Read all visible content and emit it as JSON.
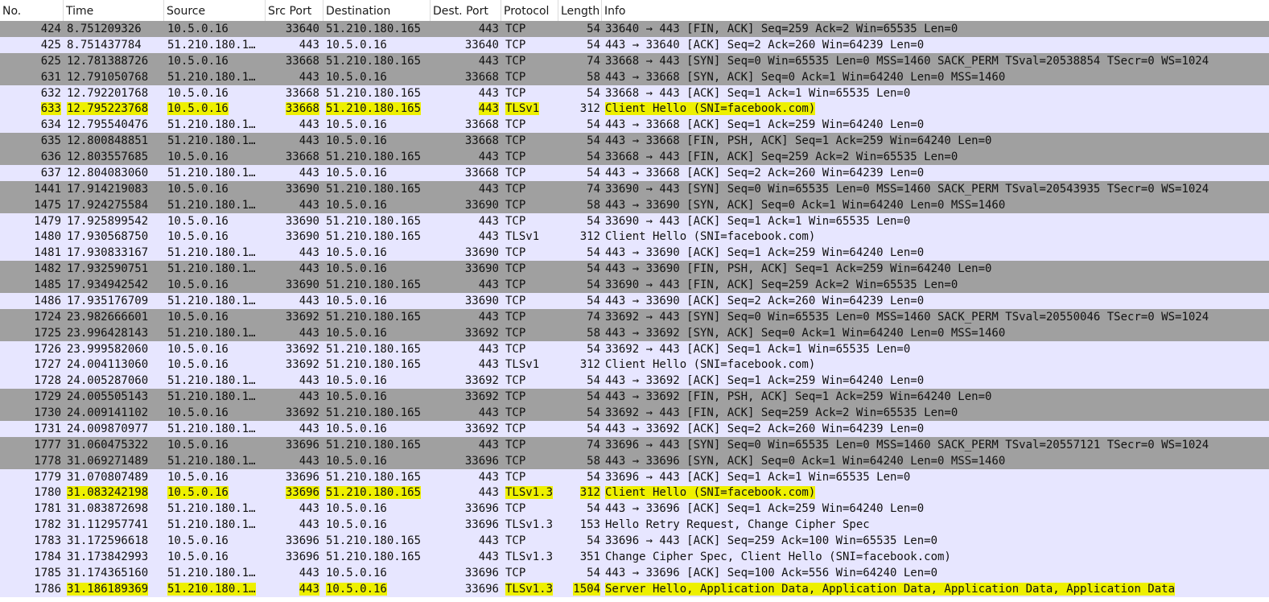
{
  "columns": [
    {
      "key": "no",
      "label": "No."
    },
    {
      "key": "time",
      "label": "Time"
    },
    {
      "key": "source",
      "label": "Source"
    },
    {
      "key": "src_port",
      "label": "Src Port"
    },
    {
      "key": "destination",
      "label": "Destination"
    },
    {
      "key": "dest_port",
      "label": "Dest. Port"
    },
    {
      "key": "protocol",
      "label": "Protocol"
    },
    {
      "key": "length",
      "label": "Length"
    },
    {
      "key": "info",
      "label": "Info"
    }
  ],
  "colors": {
    "row_gray": "#a0a0a0",
    "row_lavender": "#e7e6ff",
    "highlight": "#eef000"
  },
  "rows": [
    {
      "no": "424",
      "time": "8.751209326",
      "source": "10.5.0.16",
      "src_port": "33640",
      "destination": "51.210.180.165",
      "dest_port": "443",
      "protocol": "TCP",
      "length": "54",
      "info": "33640 → 443 [FIN, ACK] Seq=259 Ack=2 Win=65535 Len=0",
      "bg": "gray"
    },
    {
      "no": "425",
      "time": "8.751437784",
      "source": "51.210.180.1…",
      "src_port": "443",
      "destination": "10.5.0.16",
      "dest_port": "33640",
      "protocol": "TCP",
      "length": "54",
      "info": "443 → 33640 [ACK] Seq=2 Ack=260 Win=64239 Len=0",
      "bg": "lavender"
    },
    {
      "no": "625",
      "time": "12.781388726",
      "source": "10.5.0.16",
      "src_port": "33668",
      "destination": "51.210.180.165",
      "dest_port": "443",
      "protocol": "TCP",
      "length": "74",
      "info": "33668 → 443 [SYN] Seq=0 Win=65535 Len=0 MSS=1460 SACK_PERM TSval=20538854 TSecr=0 WS=1024",
      "bg": "gray"
    },
    {
      "no": "631",
      "time": "12.791050768",
      "source": "51.210.180.1…",
      "src_port": "443",
      "destination": "10.5.0.16",
      "dest_port": "33668",
      "protocol": "TCP",
      "length": "58",
      "info": "443 → 33668 [SYN, ACK] Seq=0 Ack=1 Win=64240 Len=0 MSS=1460",
      "bg": "gray"
    },
    {
      "no": "632",
      "time": "12.792201768",
      "source": "10.5.0.16",
      "src_port": "33668",
      "destination": "51.210.180.165",
      "dest_port": "443",
      "protocol": "TCP",
      "length": "54",
      "info": "33668 → 443 [ACK] Seq=1 Ack=1 Win=65535 Len=0",
      "bg": "lavender"
    },
    {
      "no": "633",
      "time": "12.795223768",
      "source": "10.5.0.16",
      "src_port": "33668",
      "destination": "51.210.180.165",
      "dest_port": "443",
      "protocol": "TLSv1",
      "length": "312",
      "info": "Client Hello (SNI=facebook.com)",
      "bg": "lavender",
      "highlight": [
        "no",
        "time",
        "source",
        "src_port",
        "destination",
        "dest_port",
        "protocol",
        "info"
      ]
    },
    {
      "no": "634",
      "time": "12.795540476",
      "source": "51.210.180.1…",
      "src_port": "443",
      "destination": "10.5.0.16",
      "dest_port": "33668",
      "protocol": "TCP",
      "length": "54",
      "info": "443 → 33668 [ACK] Seq=1 Ack=259 Win=64240 Len=0",
      "bg": "lavender"
    },
    {
      "no": "635",
      "time": "12.800848851",
      "source": "51.210.180.1…",
      "src_port": "443",
      "destination": "10.5.0.16",
      "dest_port": "33668",
      "protocol": "TCP",
      "length": "54",
      "info": "443 → 33668 [FIN, PSH, ACK] Seq=1 Ack=259 Win=64240 Len=0",
      "bg": "gray"
    },
    {
      "no": "636",
      "time": "12.803557685",
      "source": "10.5.0.16",
      "src_port": "33668",
      "destination": "51.210.180.165",
      "dest_port": "443",
      "protocol": "TCP",
      "length": "54",
      "info": "33668 → 443 [FIN, ACK] Seq=259 Ack=2 Win=65535 Len=0",
      "bg": "gray"
    },
    {
      "no": "637",
      "time": "12.804083060",
      "source": "51.210.180.1…",
      "src_port": "443",
      "destination": "10.5.0.16",
      "dest_port": "33668",
      "protocol": "TCP",
      "length": "54",
      "info": "443 → 33668 [ACK] Seq=2 Ack=260 Win=64239 Len=0",
      "bg": "lavender"
    },
    {
      "no": "1441",
      "time": "17.914219083",
      "source": "10.5.0.16",
      "src_port": "33690",
      "destination": "51.210.180.165",
      "dest_port": "443",
      "protocol": "TCP",
      "length": "74",
      "info": "33690 → 443 [SYN] Seq=0 Win=65535 Len=0 MSS=1460 SACK_PERM TSval=20543935 TSecr=0 WS=1024",
      "bg": "gray"
    },
    {
      "no": "1475",
      "time": "17.924275584",
      "source": "51.210.180.1…",
      "src_port": "443",
      "destination": "10.5.0.16",
      "dest_port": "33690",
      "protocol": "TCP",
      "length": "58",
      "info": "443 → 33690 [SYN, ACK] Seq=0 Ack=1 Win=64240 Len=0 MSS=1460",
      "bg": "gray"
    },
    {
      "no": "1479",
      "time": "17.925899542",
      "source": "10.5.0.16",
      "src_port": "33690",
      "destination": "51.210.180.165",
      "dest_port": "443",
      "protocol": "TCP",
      "length": "54",
      "info": "33690 → 443 [ACK] Seq=1 Ack=1 Win=65535 Len=0",
      "bg": "lavender"
    },
    {
      "no": "1480",
      "time": "17.930568750",
      "source": "10.5.0.16",
      "src_port": "33690",
      "destination": "51.210.180.165",
      "dest_port": "443",
      "protocol": "TLSv1",
      "length": "312",
      "info": "Client Hello (SNI=facebook.com)",
      "bg": "lavender"
    },
    {
      "no": "1481",
      "time": "17.930833167",
      "source": "51.210.180.1…",
      "src_port": "443",
      "destination": "10.5.0.16",
      "dest_port": "33690",
      "protocol": "TCP",
      "length": "54",
      "info": "443 → 33690 [ACK] Seq=1 Ack=259 Win=64240 Len=0",
      "bg": "lavender"
    },
    {
      "no": "1482",
      "time": "17.932590751",
      "source": "51.210.180.1…",
      "src_port": "443",
      "destination": "10.5.0.16",
      "dest_port": "33690",
      "protocol": "TCP",
      "length": "54",
      "info": "443 → 33690 [FIN, PSH, ACK] Seq=1 Ack=259 Win=64240 Len=0",
      "bg": "gray"
    },
    {
      "no": "1485",
      "time": "17.934942542",
      "source": "10.5.0.16",
      "src_port": "33690",
      "destination": "51.210.180.165",
      "dest_port": "443",
      "protocol": "TCP",
      "length": "54",
      "info": "33690 → 443 [FIN, ACK] Seq=259 Ack=2 Win=65535 Len=0",
      "bg": "gray"
    },
    {
      "no": "1486",
      "time": "17.935176709",
      "source": "51.210.180.1…",
      "src_port": "443",
      "destination": "10.5.0.16",
      "dest_port": "33690",
      "protocol": "TCP",
      "length": "54",
      "info": "443 → 33690 [ACK] Seq=2 Ack=260 Win=64239 Len=0",
      "bg": "lavender"
    },
    {
      "no": "1724",
      "time": "23.982666601",
      "source": "10.5.0.16",
      "src_port": "33692",
      "destination": "51.210.180.165",
      "dest_port": "443",
      "protocol": "TCP",
      "length": "74",
      "info": "33692 → 443 [SYN] Seq=0 Win=65535 Len=0 MSS=1460 SACK_PERM TSval=20550046 TSecr=0 WS=1024",
      "bg": "gray"
    },
    {
      "no": "1725",
      "time": "23.996428143",
      "source": "51.210.180.1…",
      "src_port": "443",
      "destination": "10.5.0.16",
      "dest_port": "33692",
      "protocol": "TCP",
      "length": "58",
      "info": "443 → 33692 [SYN, ACK] Seq=0 Ack=1 Win=64240 Len=0 MSS=1460",
      "bg": "gray"
    },
    {
      "no": "1726",
      "time": "23.999582060",
      "source": "10.5.0.16",
      "src_port": "33692",
      "destination": "51.210.180.165",
      "dest_port": "443",
      "protocol": "TCP",
      "length": "54",
      "info": "33692 → 443 [ACK] Seq=1 Ack=1 Win=65535 Len=0",
      "bg": "lavender"
    },
    {
      "no": "1727",
      "time": "24.004113060",
      "source": "10.5.0.16",
      "src_port": "33692",
      "destination": "51.210.180.165",
      "dest_port": "443",
      "protocol": "TLSv1",
      "length": "312",
      "info": "Client Hello (SNI=facebook.com)",
      "bg": "lavender"
    },
    {
      "no": "1728",
      "time": "24.005287060",
      "source": "51.210.180.1…",
      "src_port": "443",
      "destination": "10.5.0.16",
      "dest_port": "33692",
      "protocol": "TCP",
      "length": "54",
      "info": "443 → 33692 [ACK] Seq=1 Ack=259 Win=64240 Len=0",
      "bg": "lavender"
    },
    {
      "no": "1729",
      "time": "24.005505143",
      "source": "51.210.180.1…",
      "src_port": "443",
      "destination": "10.5.0.16",
      "dest_port": "33692",
      "protocol": "TCP",
      "length": "54",
      "info": "443 → 33692 [FIN, PSH, ACK] Seq=1 Ack=259 Win=64240 Len=0",
      "bg": "gray"
    },
    {
      "no": "1730",
      "time": "24.009141102",
      "source": "10.5.0.16",
      "src_port": "33692",
      "destination": "51.210.180.165",
      "dest_port": "443",
      "protocol": "TCP",
      "length": "54",
      "info": "33692 → 443 [FIN, ACK] Seq=259 Ack=2 Win=65535 Len=0",
      "bg": "gray"
    },
    {
      "no": "1731",
      "time": "24.009870977",
      "source": "51.210.180.1…",
      "src_port": "443",
      "destination": "10.5.0.16",
      "dest_port": "33692",
      "protocol": "TCP",
      "length": "54",
      "info": "443 → 33692 [ACK] Seq=2 Ack=260 Win=64239 Len=0",
      "bg": "lavender"
    },
    {
      "no": "1777",
      "time": "31.060475322",
      "source": "10.5.0.16",
      "src_port": "33696",
      "destination": "51.210.180.165",
      "dest_port": "443",
      "protocol": "TCP",
      "length": "74",
      "info": "33696 → 443 [SYN] Seq=0 Win=65535 Len=0 MSS=1460 SACK_PERM TSval=20557121 TSecr=0 WS=1024",
      "bg": "gray"
    },
    {
      "no": "1778",
      "time": "31.069271489",
      "source": "51.210.180.1…",
      "src_port": "443",
      "destination": "10.5.0.16",
      "dest_port": "33696",
      "protocol": "TCP",
      "length": "58",
      "info": "443 → 33696 [SYN, ACK] Seq=0 Ack=1 Win=64240 Len=0 MSS=1460",
      "bg": "gray"
    },
    {
      "no": "1779",
      "time": "31.070807489",
      "source": "10.5.0.16",
      "src_port": "33696",
      "destination": "51.210.180.165",
      "dest_port": "443",
      "protocol": "TCP",
      "length": "54",
      "info": "33696 → 443 [ACK] Seq=1 Ack=1 Win=65535 Len=0",
      "bg": "lavender"
    },
    {
      "no": "1780",
      "time": "31.083242198",
      "source": "10.5.0.16",
      "src_port": "33696",
      "destination": "51.210.180.165",
      "dest_port": "443",
      "protocol": "TLSv1.3",
      "length": "312",
      "info": "Client Hello (SNI=facebook.com)",
      "bg": "lavender",
      "highlight": [
        "time",
        "source",
        "src_port",
        "destination",
        "protocol",
        "length",
        "info"
      ]
    },
    {
      "no": "1781",
      "time": "31.083872698",
      "source": "51.210.180.1…",
      "src_port": "443",
      "destination": "10.5.0.16",
      "dest_port": "33696",
      "protocol": "TCP",
      "length": "54",
      "info": "443 → 33696 [ACK] Seq=1 Ack=259 Win=64240 Len=0",
      "bg": "lavender"
    },
    {
      "no": "1782",
      "time": "31.112957741",
      "source": "51.210.180.1…",
      "src_port": "443",
      "destination": "10.5.0.16",
      "dest_port": "33696",
      "protocol": "TLSv1.3",
      "length": "153",
      "info": "Hello Retry Request, Change Cipher Spec",
      "bg": "lavender"
    },
    {
      "no": "1783",
      "time": "31.172596618",
      "source": "10.5.0.16",
      "src_port": "33696",
      "destination": "51.210.180.165",
      "dest_port": "443",
      "protocol": "TCP",
      "length": "54",
      "info": "33696 → 443 [ACK] Seq=259 Ack=100 Win=65535 Len=0",
      "bg": "lavender"
    },
    {
      "no": "1784",
      "time": "31.173842993",
      "source": "10.5.0.16",
      "src_port": "33696",
      "destination": "51.210.180.165",
      "dest_port": "443",
      "protocol": "TLSv1.3",
      "length": "351",
      "info": "Change Cipher Spec, Client Hello (SNI=facebook.com)",
      "bg": "lavender"
    },
    {
      "no": "1785",
      "time": "31.174365160",
      "source": "51.210.180.1…",
      "src_port": "443",
      "destination": "10.5.0.16",
      "dest_port": "33696",
      "protocol": "TCP",
      "length": "54",
      "info": "443 → 33696 [ACK] Seq=100 Ack=556 Win=64240 Len=0",
      "bg": "lavender"
    },
    {
      "no": "1786",
      "time": "31.186189369",
      "source": "51.210.180.1…",
      "src_port": "443",
      "destination": "10.5.0.16",
      "dest_port": "33696",
      "protocol": "TLSv1.3",
      "length": "1504",
      "info": "Server Hello, Application Data, Application Data, Application Data, Application Data",
      "bg": "lavender",
      "highlight": [
        "time",
        "source",
        "src_port",
        "destination",
        "protocol",
        "length",
        "info"
      ]
    }
  ]
}
